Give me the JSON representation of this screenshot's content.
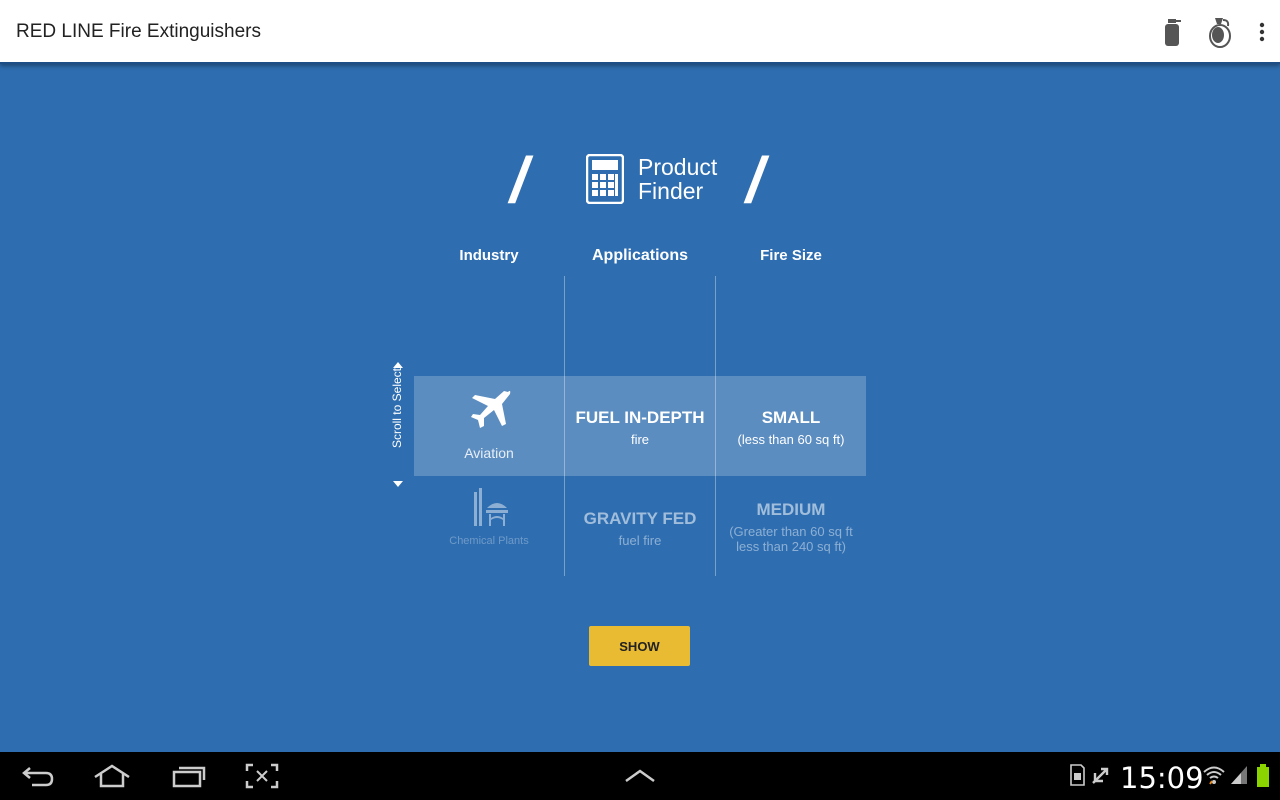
{
  "app": {
    "title": "RED LINE Fire Extinguishers",
    "actions": [
      {
        "icon": "fire-extinguisher-icon"
      },
      {
        "icon": "grenade-icon"
      },
      {
        "icon": "overflow-menu-icon"
      }
    ]
  },
  "finder": {
    "slash_left": "/",
    "slash_right": "/",
    "title_line1": "Product",
    "title_line2": "Finder",
    "icon": "calculator-icon",
    "scroll_hint": "Scroll to Select",
    "columns": {
      "industry": "Industry",
      "applications": "Applications",
      "fire_size": "Fire Size"
    },
    "industry": {
      "selected": {
        "label": "Aviation",
        "icon": "airplane-icon"
      },
      "next": {
        "label": "Chemical Plants",
        "icon": "chemical-plant-icon"
      }
    },
    "applications": {
      "selected": {
        "title": "FUEL IN-DEPTH",
        "subtitle": "fire"
      },
      "next": {
        "title": "GRAVITY FED",
        "subtitle": "fuel fire"
      }
    },
    "fire_size": {
      "selected": {
        "title": "SMALL",
        "subtitle": "(less than 60 sq ft)"
      },
      "next": {
        "title": "MEDIUM",
        "subtitle_line1": "(Greater than 60 sq ft",
        "subtitle_line2": "less than 240 sq ft)"
      }
    },
    "show_label": "SHOW"
  },
  "system": {
    "clock": "15:09",
    "nav": [
      "back-icon",
      "home-icon",
      "recent-apps-icon",
      "screenshot-icon",
      "chevron-up-icon"
    ],
    "status_icons": [
      "sd-card-icon",
      "sync-icon",
      "wifi-icon",
      "signal-icon",
      "battery-icon"
    ],
    "colors": {
      "accent": "#e8bb32",
      "background": "#2e6db0"
    }
  }
}
